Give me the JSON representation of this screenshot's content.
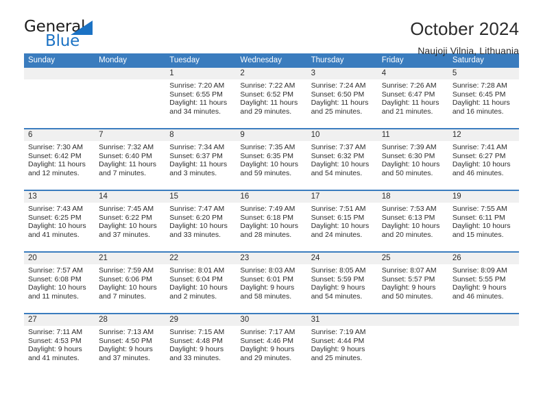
{
  "brand": {
    "name_part1": "General",
    "name_part2": "Blue",
    "triangle_icon": "brand-triangle-icon",
    "accent_color": "#1b72c4"
  },
  "header": {
    "title": "October 2024",
    "subtitle": "Naujoji Vilnia, Lithuania"
  },
  "calendar": {
    "header_bg": "#3a7cbe",
    "daynum_bg": "#f0f0f0",
    "weekdays": [
      "Sunday",
      "Monday",
      "Tuesday",
      "Wednesday",
      "Thursday",
      "Friday",
      "Saturday"
    ],
    "weeks": [
      [
        {
          "day": "",
          "lines": []
        },
        {
          "day": "",
          "lines": []
        },
        {
          "day": "1",
          "lines": [
            "Sunrise: 7:20 AM",
            "Sunset: 6:55 PM",
            "Daylight: 11 hours",
            "and 34 minutes."
          ]
        },
        {
          "day": "2",
          "lines": [
            "Sunrise: 7:22 AM",
            "Sunset: 6:52 PM",
            "Daylight: 11 hours",
            "and 29 minutes."
          ]
        },
        {
          "day": "3",
          "lines": [
            "Sunrise: 7:24 AM",
            "Sunset: 6:50 PM",
            "Daylight: 11 hours",
            "and 25 minutes."
          ]
        },
        {
          "day": "4",
          "lines": [
            "Sunrise: 7:26 AM",
            "Sunset: 6:47 PM",
            "Daylight: 11 hours",
            "and 21 minutes."
          ]
        },
        {
          "day": "5",
          "lines": [
            "Sunrise: 7:28 AM",
            "Sunset: 6:45 PM",
            "Daylight: 11 hours",
            "and 16 minutes."
          ]
        }
      ],
      [
        {
          "day": "6",
          "lines": [
            "Sunrise: 7:30 AM",
            "Sunset: 6:42 PM",
            "Daylight: 11 hours",
            "and 12 minutes."
          ]
        },
        {
          "day": "7",
          "lines": [
            "Sunrise: 7:32 AM",
            "Sunset: 6:40 PM",
            "Daylight: 11 hours",
            "and 7 minutes."
          ]
        },
        {
          "day": "8",
          "lines": [
            "Sunrise: 7:34 AM",
            "Sunset: 6:37 PM",
            "Daylight: 11 hours",
            "and 3 minutes."
          ]
        },
        {
          "day": "9",
          "lines": [
            "Sunrise: 7:35 AM",
            "Sunset: 6:35 PM",
            "Daylight: 10 hours",
            "and 59 minutes."
          ]
        },
        {
          "day": "10",
          "lines": [
            "Sunrise: 7:37 AM",
            "Sunset: 6:32 PM",
            "Daylight: 10 hours",
            "and 54 minutes."
          ]
        },
        {
          "day": "11",
          "lines": [
            "Sunrise: 7:39 AM",
            "Sunset: 6:30 PM",
            "Daylight: 10 hours",
            "and 50 minutes."
          ]
        },
        {
          "day": "12",
          "lines": [
            "Sunrise: 7:41 AM",
            "Sunset: 6:27 PM",
            "Daylight: 10 hours",
            "and 46 minutes."
          ]
        }
      ],
      [
        {
          "day": "13",
          "lines": [
            "Sunrise: 7:43 AM",
            "Sunset: 6:25 PM",
            "Daylight: 10 hours",
            "and 41 minutes."
          ]
        },
        {
          "day": "14",
          "lines": [
            "Sunrise: 7:45 AM",
            "Sunset: 6:22 PM",
            "Daylight: 10 hours",
            "and 37 minutes."
          ]
        },
        {
          "day": "15",
          "lines": [
            "Sunrise: 7:47 AM",
            "Sunset: 6:20 PM",
            "Daylight: 10 hours",
            "and 33 minutes."
          ]
        },
        {
          "day": "16",
          "lines": [
            "Sunrise: 7:49 AM",
            "Sunset: 6:18 PM",
            "Daylight: 10 hours",
            "and 28 minutes."
          ]
        },
        {
          "day": "17",
          "lines": [
            "Sunrise: 7:51 AM",
            "Sunset: 6:15 PM",
            "Daylight: 10 hours",
            "and 24 minutes."
          ]
        },
        {
          "day": "18",
          "lines": [
            "Sunrise: 7:53 AM",
            "Sunset: 6:13 PM",
            "Daylight: 10 hours",
            "and 20 minutes."
          ]
        },
        {
          "day": "19",
          "lines": [
            "Sunrise: 7:55 AM",
            "Sunset: 6:11 PM",
            "Daylight: 10 hours",
            "and 15 minutes."
          ]
        }
      ],
      [
        {
          "day": "20",
          "lines": [
            "Sunrise: 7:57 AM",
            "Sunset: 6:08 PM",
            "Daylight: 10 hours",
            "and 11 minutes."
          ]
        },
        {
          "day": "21",
          "lines": [
            "Sunrise: 7:59 AM",
            "Sunset: 6:06 PM",
            "Daylight: 10 hours",
            "and 7 minutes."
          ]
        },
        {
          "day": "22",
          "lines": [
            "Sunrise: 8:01 AM",
            "Sunset: 6:04 PM",
            "Daylight: 10 hours",
            "and 2 minutes."
          ]
        },
        {
          "day": "23",
          "lines": [
            "Sunrise: 8:03 AM",
            "Sunset: 6:01 PM",
            "Daylight: 9 hours",
            "and 58 minutes."
          ]
        },
        {
          "day": "24",
          "lines": [
            "Sunrise: 8:05 AM",
            "Sunset: 5:59 PM",
            "Daylight: 9 hours",
            "and 54 minutes."
          ]
        },
        {
          "day": "25",
          "lines": [
            "Sunrise: 8:07 AM",
            "Sunset: 5:57 PM",
            "Daylight: 9 hours",
            "and 50 minutes."
          ]
        },
        {
          "day": "26",
          "lines": [
            "Sunrise: 8:09 AM",
            "Sunset: 5:55 PM",
            "Daylight: 9 hours",
            "and 46 minutes."
          ]
        }
      ],
      [
        {
          "day": "27",
          "lines": [
            "Sunrise: 7:11 AM",
            "Sunset: 4:53 PM",
            "Daylight: 9 hours",
            "and 41 minutes."
          ]
        },
        {
          "day": "28",
          "lines": [
            "Sunrise: 7:13 AM",
            "Sunset: 4:50 PM",
            "Daylight: 9 hours",
            "and 37 minutes."
          ]
        },
        {
          "day": "29",
          "lines": [
            "Sunrise: 7:15 AM",
            "Sunset: 4:48 PM",
            "Daylight: 9 hours",
            "and 33 minutes."
          ]
        },
        {
          "day": "30",
          "lines": [
            "Sunrise: 7:17 AM",
            "Sunset: 4:46 PM",
            "Daylight: 9 hours",
            "and 29 minutes."
          ]
        },
        {
          "day": "31",
          "lines": [
            "Sunrise: 7:19 AM",
            "Sunset: 4:44 PM",
            "Daylight: 9 hours",
            "and 25 minutes."
          ]
        },
        {
          "day": "",
          "lines": []
        },
        {
          "day": "",
          "lines": []
        }
      ]
    ]
  }
}
